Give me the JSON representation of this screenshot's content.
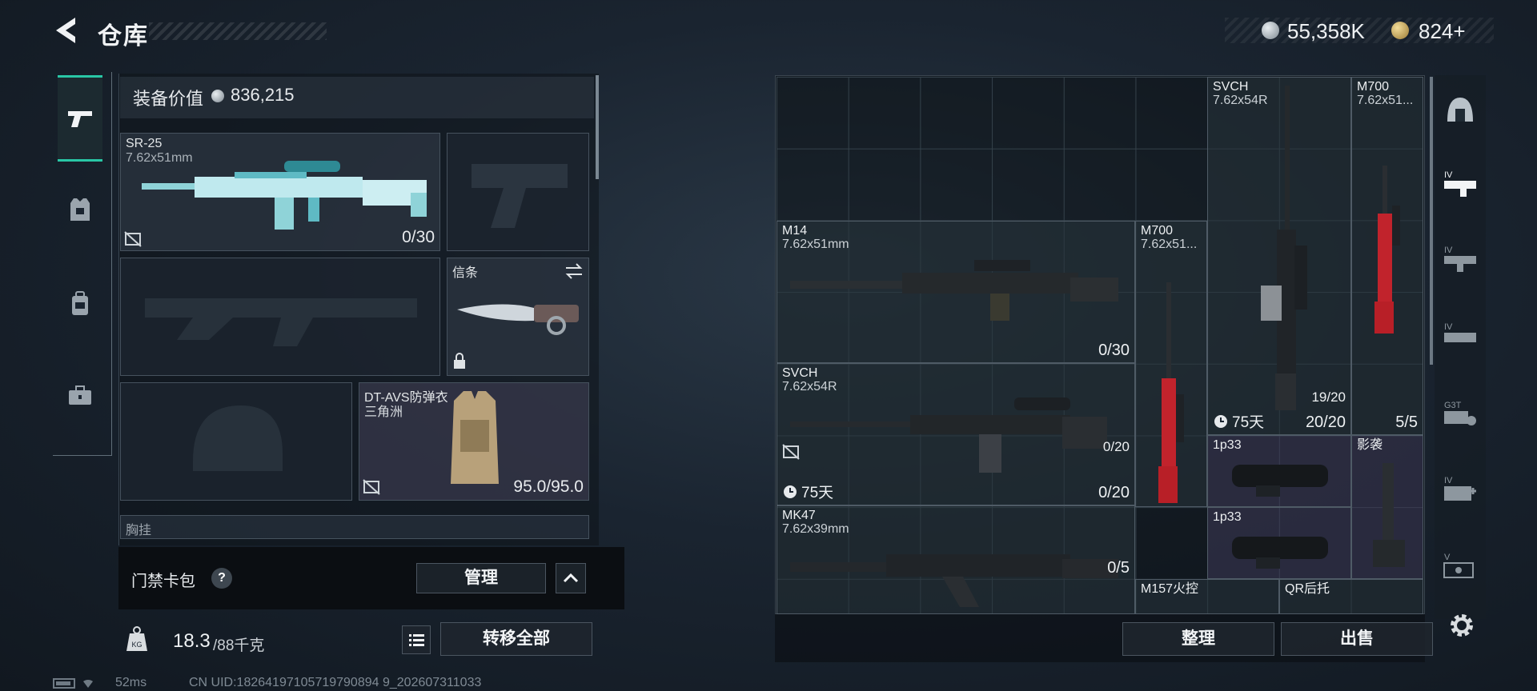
{
  "header": {
    "title": "仓库",
    "silver_amount": "55,358K",
    "gold_amount": "824+"
  },
  "left_nav": {
    "items": [
      "firearms-icon",
      "armor-icon",
      "backpack-icon",
      "toolbox-icon"
    ]
  },
  "equipment": {
    "value_label": "装备价值",
    "value": "836,215",
    "primary": {
      "name": "SR-25",
      "caliber": "7.62x51mm",
      "ammo": "0/30"
    },
    "melee": {
      "name": "信条"
    },
    "armor": {
      "name": "DT-AVS防弹衣",
      "sub": "三角洲",
      "durability": "95.0/95.0"
    },
    "next_section": "胸挂"
  },
  "access": {
    "label": "门禁卡包",
    "help": "?",
    "manage": "管理"
  },
  "weight": {
    "current": "18.3",
    "max": "/88千克",
    "icon_label": "KG"
  },
  "transfer_all": "转移全部",
  "status": {
    "ping": "52ms",
    "uid": "CN UID:18264197105719790894 9_202607311033"
  },
  "stash": {
    "items": [
      {
        "name": "M14",
        "sub": "7.62x51mm",
        "count": "0/30"
      },
      {
        "name": "SVCH",
        "sub": "7.62x54R",
        "count": "0/20",
        "timer": "75天",
        "extra": "0/20"
      },
      {
        "name": "MK47",
        "sub": "7.62x39mm",
        "count": "0/5"
      },
      {
        "name": "M700",
        "sub": "7.62x51..."
      },
      {
        "name": "SVCH",
        "sub": "7.62x54R",
        "count": "20/20",
        "timer": "75天",
        "extra": "19/20"
      },
      {
        "name": "M700",
        "sub": "7.62x51...",
        "count": "5/5"
      },
      {
        "name": "1p33"
      },
      {
        "name": "1p33"
      },
      {
        "name": "影袭"
      },
      {
        "name": "M157火控"
      },
      {
        "name": "QR后托"
      }
    ],
    "tidy": "整理",
    "sell": "出售"
  },
  "right_nav": {
    "items": [
      "helmet-icon",
      "tier-iv-rifle-icon",
      "tier-iv-smg-icon",
      "tier-iv-shotgun-icon",
      "g3t-icon",
      "tier-iv-medkit-icon",
      "tier-v-case-icon",
      "settings-icon"
    ]
  }
}
